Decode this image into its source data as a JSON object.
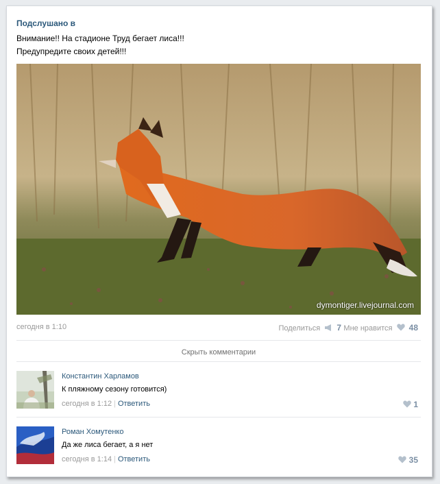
{
  "post": {
    "group_name": "Подслушано в",
    "text_line1": "Внимание!! На стадионе Труд бегает лиса!!!",
    "text_line2": "Предупредите своих детей!!!",
    "photo_watermark": "dymontiger.livejournal.com",
    "time": "сегодня в 1:10",
    "share_label": "Поделиться",
    "share_count": "7",
    "like_label": "Мне нравится",
    "like_count": "48",
    "hide_comments_label": "Скрыть комментарии"
  },
  "comments": [
    {
      "author": "Константин Харламов",
      "text": "К пляжному сезону готовится)",
      "time": "сегодня в 1:12",
      "reply_label": "Ответить",
      "likes": "1"
    },
    {
      "author": "Роман Хомутенко",
      "text": "Да же лиса бегает, а я нет",
      "time": "сегодня в 1:14",
      "reply_label": "Ответить",
      "likes": "35"
    }
  ],
  "colors": {
    "link": "#2b587a",
    "meta": "#999999",
    "like_count": "#7b8fa4"
  },
  "icons": {
    "share": "megaphone-icon",
    "like": "heart-icon"
  }
}
